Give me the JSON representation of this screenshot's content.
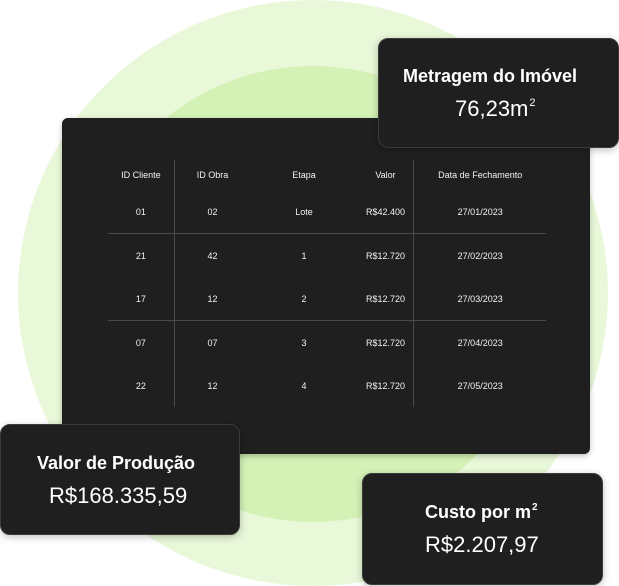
{
  "table": {
    "headers": [
      "ID Cliente",
      "ID Obra",
      "Etapa",
      "Valor",
      "Data de Fechamento"
    ],
    "rows": [
      [
        "01",
        "02",
        "Lote",
        "R$42.400",
        "27/01/2023"
      ],
      [
        "21",
        "42",
        "1",
        "R$12.720",
        "27/02/2023"
      ],
      [
        "17",
        "12",
        "2",
        "R$12.720",
        "27/03/2023"
      ],
      [
        "07",
        "07",
        "3",
        "R$12.720",
        "27/04/2023"
      ],
      [
        "22",
        "12",
        "4",
        "R$12.720",
        "27/05/2023"
      ]
    ]
  },
  "metragem": {
    "label": "Metragem do Imóvel",
    "value": "76,23m",
    "unit_exponent": "2"
  },
  "producao": {
    "label": "Valor de Produção",
    "value": "R$168.335,59"
  },
  "custo": {
    "label": "Custo por m",
    "label_exponent": "2",
    "value": "R$2.207,97"
  },
  "colors": {
    "card_bg": "#1f1f1f",
    "text": "#ffffff",
    "ring_outer": "#e9f8d9",
    "ring_inner": "#9fe05a",
    "divider": "#4a4a4a"
  }
}
